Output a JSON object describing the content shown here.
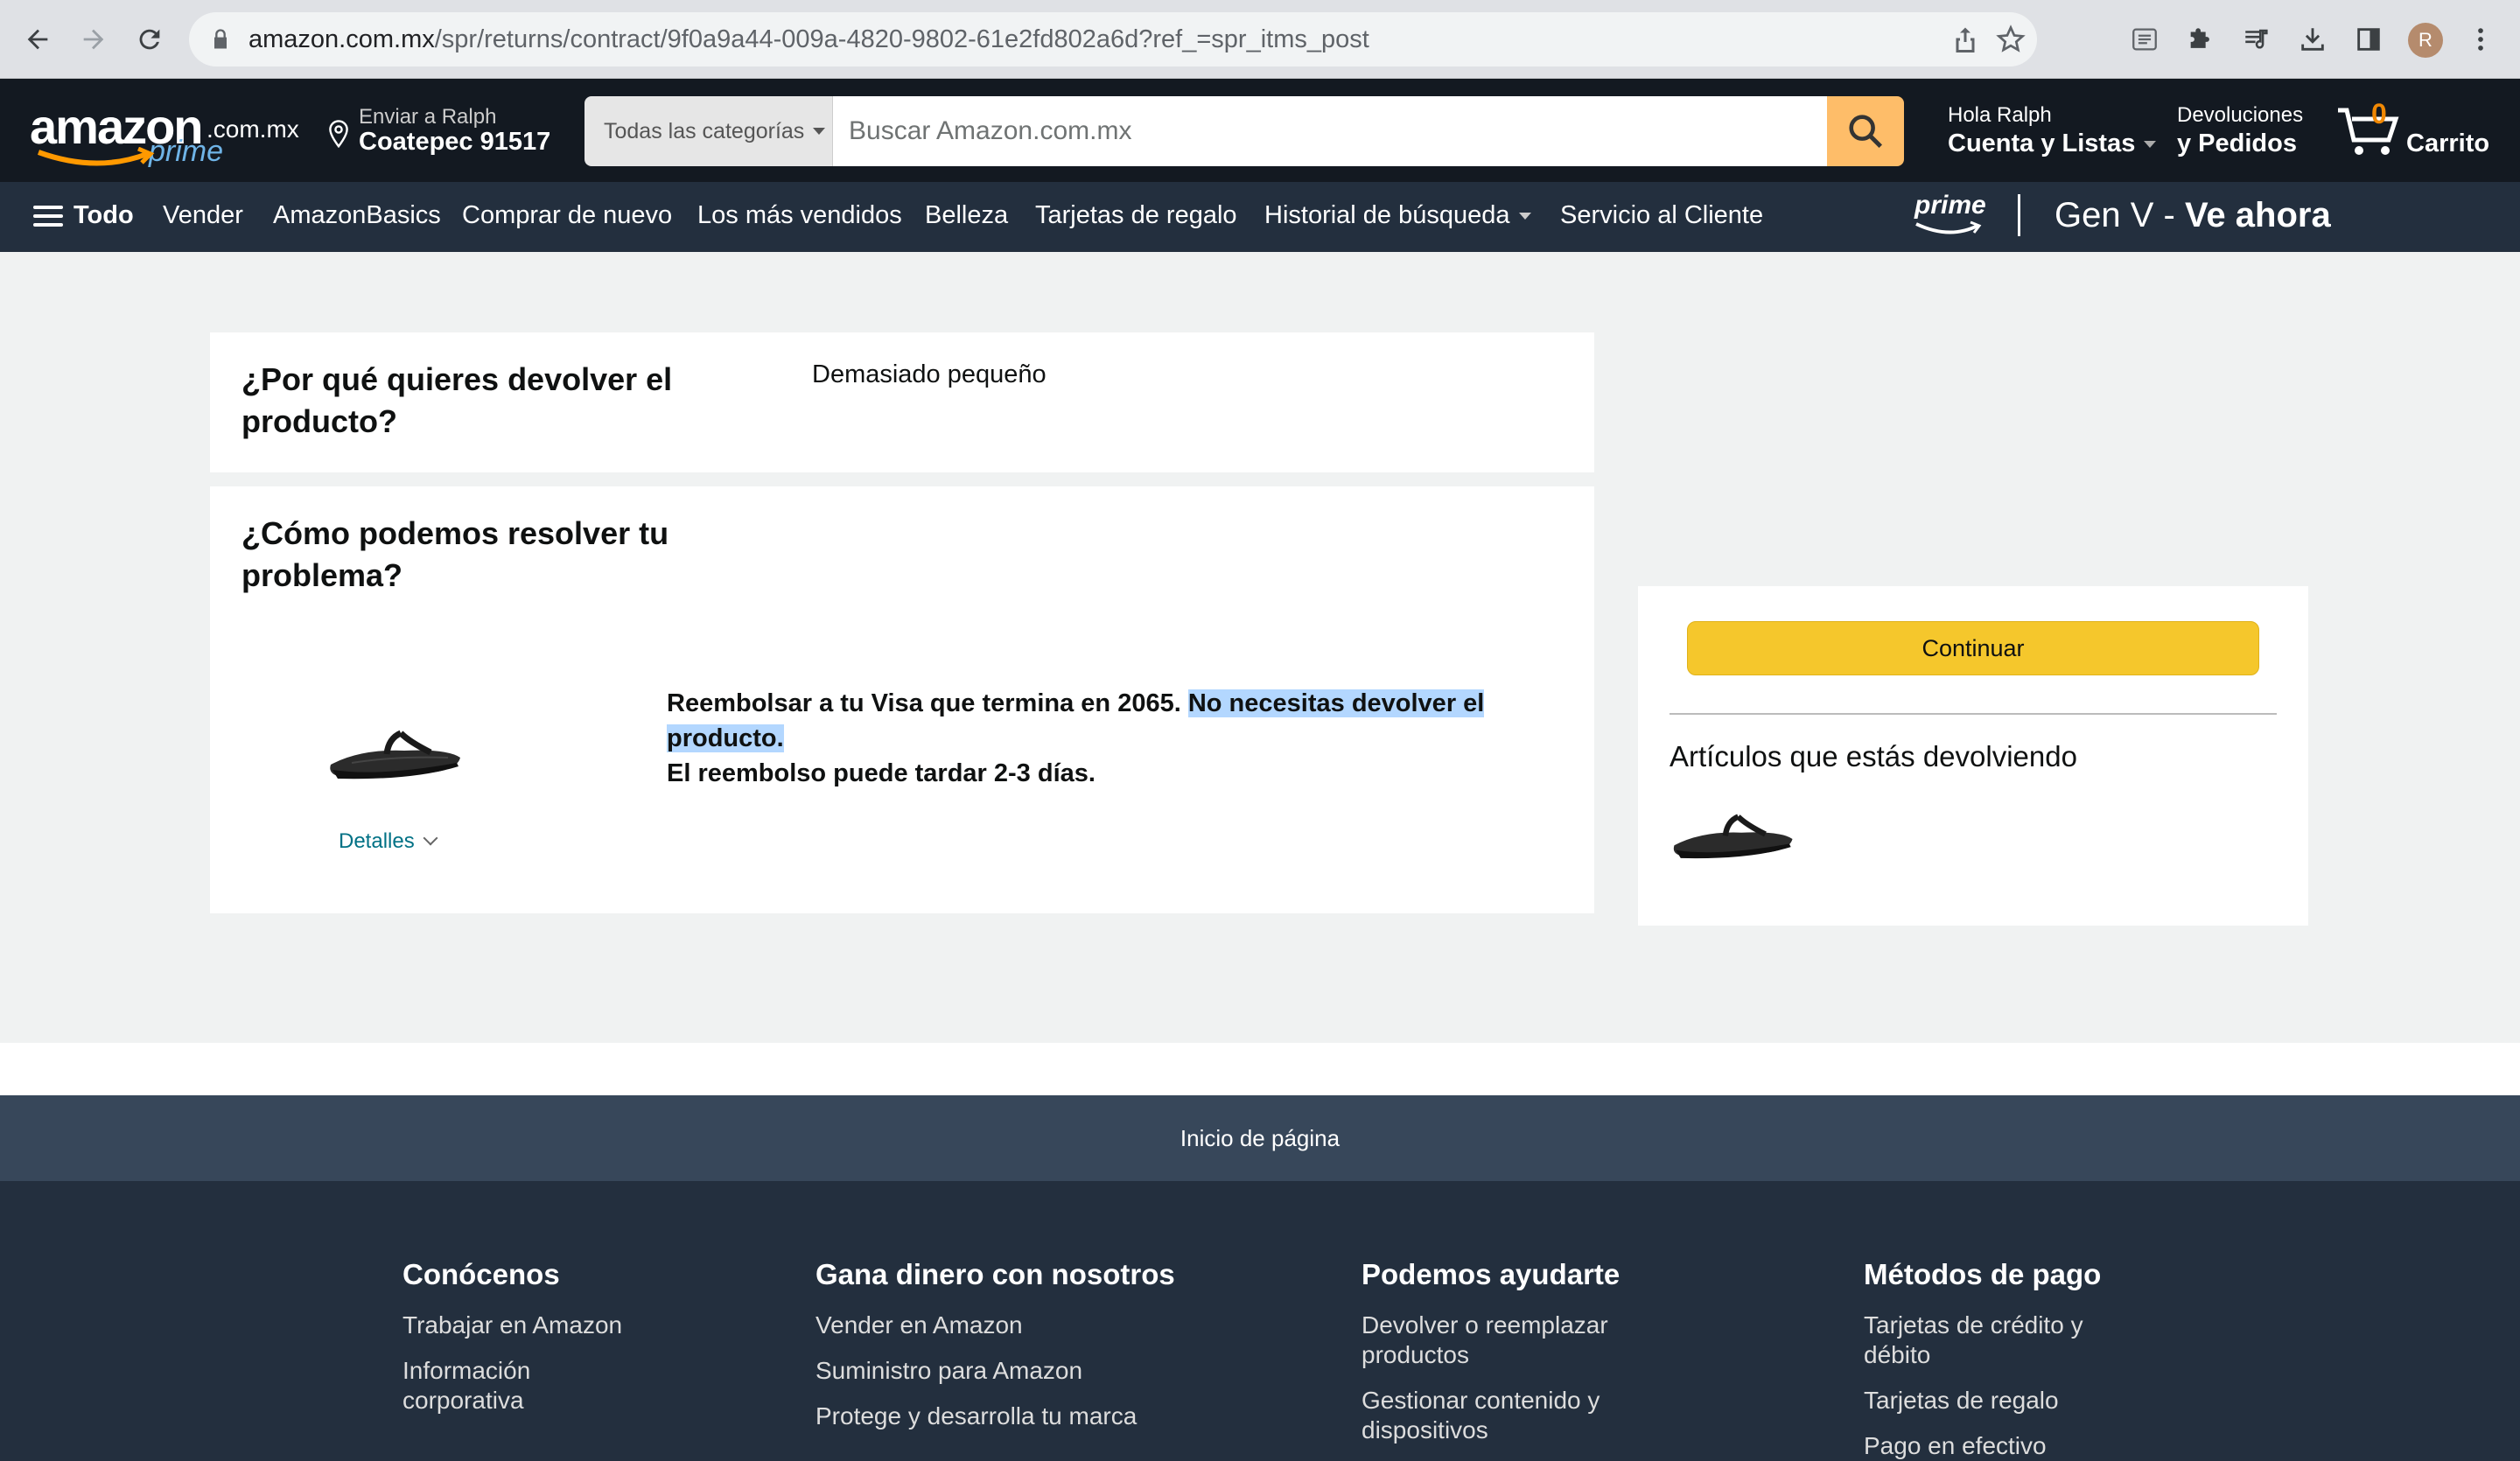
{
  "browser": {
    "url_host": "amazon.com.mx",
    "url_path": "/spr/returns/contract/9f0a9a44-009a-4820-9802-61e2fd802a6d?ref_=spr_itms_post",
    "profile_initial": "R"
  },
  "header": {
    "logo_word": "amazon",
    "logo_tld": ".com.mx",
    "logo_prime": "prime",
    "deliver_line1": "Enviar a Ralph",
    "deliver_line2": "Coatepec 91517",
    "search_category": "Todas las categorías",
    "search_placeholder": "Buscar Amazon.com.mx",
    "account_line1": "Hola Ralph",
    "account_line2": "Cuenta y Listas",
    "returns_line1": "Devoluciones",
    "returns_line2": "y Pedidos",
    "cart_count": "0",
    "cart_label": "Carrito"
  },
  "nav": {
    "todo": "Todo",
    "items": [
      "Vender",
      "AmazonBasics",
      "Comprar de nuevo",
      "Los más vendidos",
      "Belleza",
      "Tarjetas de regalo",
      "Historial de búsqueda",
      "Servicio al Cliente"
    ],
    "promo_prime": "prime",
    "promo_title_a": "Gen V - ",
    "promo_title_b": "Ve ahora"
  },
  "reason": {
    "question": "¿Por qué quieres devolver el producto?",
    "answer": "Demasiado pequeño"
  },
  "resolve": {
    "question": "¿Cómo podemos resolver tu problema?",
    "refund_a": "Reembolsar a tu Visa que termina en 2065. ",
    "refund_highlight": "No necesitas devolver el producto.",
    "refund_b": "El reembolso puede tardar 2-3 días.",
    "details": "Detalles"
  },
  "side": {
    "continue": "Continuar",
    "returning_header": "Artículos que estás devolviendo"
  },
  "footer": {
    "back_to_top": "Inicio de página",
    "columns": [
      {
        "title": "Conócenos",
        "links": [
          "Trabajar en Amazon",
          "Información corporativa"
        ]
      },
      {
        "title": "Gana dinero con nosotros",
        "links": [
          "Vender en Amazon",
          "Suministro para Amazon",
          "Protege y desarrolla tu marca"
        ]
      },
      {
        "title": "Podemos ayudarte",
        "links": [
          "Devolver o reemplazar productos",
          "Gestionar contenido y dispositivos"
        ]
      },
      {
        "title": "Métodos de pago",
        "links": [
          "Tarjetas de crédito y débito",
          "Tarjetas de regalo",
          "Pago en efectivo"
        ]
      }
    ]
  },
  "colors": {
    "nav_belt": "#131921",
    "nav_main": "#232f3e",
    "search_button": "#febd69",
    "continue_button": "#f5c72c",
    "link": "#007185",
    "cart_count": "#f08804",
    "selection": "#b3d7ff"
  },
  "icons": [
    "back-icon",
    "forward-icon",
    "reload-icon",
    "lock-icon",
    "share-icon",
    "star-icon",
    "reader-icon",
    "puzzle-icon",
    "media-icon",
    "download-icon",
    "sidepanel-icon",
    "more-icon",
    "location-pin-icon",
    "search-icon",
    "cart-icon",
    "menu-icon",
    "flip-flop-image"
  ]
}
